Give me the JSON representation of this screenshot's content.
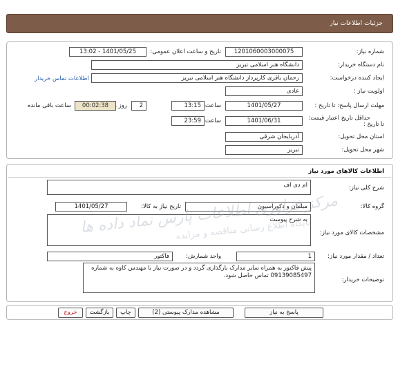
{
  "header": {
    "title": "جزئیات اطلاعات نیاز"
  },
  "need_info": {
    "need_number_label": "شماره نیاز:",
    "need_number": "1201060003000075",
    "announce_label": "تاریخ و ساعت اعلان عمومی:",
    "announce_value": "1401/05/25 - 13:02",
    "buyer_org_label": "نام دستگاه خریدار:",
    "buyer_org": "دانشگاه هنر اسلامی تبریز",
    "requester_label": "ایجاد کننده درخواست:",
    "requester": "رحمان باقری کارپرداز دانشگاه هنر اسلامی تبریز",
    "contact_link": "اطلاعات تماس خریدار",
    "priority_label": "اولویت نیاز :",
    "priority": "عادی",
    "reply_deadline_label": "مهلت ارسال پاسخ: تا تاریخ :",
    "reply_deadline_date": "1401/05/27",
    "time_label": "ساعت",
    "reply_deadline_time": "13:15",
    "days_value": "2",
    "days_label": "روز و",
    "remaining_time": "00:02:38",
    "remaining_label": "ساعت باقی مانده",
    "validity_label": "حداقل تاریخ اعتبار قیمت:",
    "validity_to_label": "تا تاریخ :",
    "validity_date": "1401/06/31",
    "validity_time": "23:59",
    "province_label": "استان محل تحویل:",
    "province": "آذربایجان شرقی",
    "city_label": "شهر محل تحویل:",
    "city": "تبریز"
  },
  "goods": {
    "section_title": "اطلاعات کالاهای مورد نیاز",
    "summary_label": "شرح کلی نیاز:",
    "summary": "ام دی اف",
    "group_label": "گروه کالا:",
    "group": "مبلمان و دکوراسیون",
    "need_date_label": "تاریخ نیاز به کالا:",
    "need_date": "1401/05/27",
    "specs_label": "مشخصات کالای مورد نیاز:",
    "specs": "به شرح پیوست",
    "qty_label": "تعداد / مقدار مورد نیاز:",
    "qty": "1",
    "unit_label": "واحد شمارش:",
    "unit": "فاکتور",
    "buyer_notes_label": "توضیحات خریدار:",
    "buyer_notes": "پیش فاکتور به همراه سایر مدارک بارگذاری گردد و در صورت نیاز با مهندس کاوه به شماره 09139085497 تماس حاصل شود."
  },
  "actions": {
    "reply": "پاسخ به نیاز",
    "attachments": "مشاهده مدارک پیوستی (2)",
    "print": "چاپ",
    "back": "بازگشت",
    "exit": "خروج"
  },
  "watermark": {
    "line1": "مرکز فراوری اطلاعات پارس نماد داده ها",
    "line2": "پایگاه اطلاع رسانی مناقصه و مزایده"
  }
}
